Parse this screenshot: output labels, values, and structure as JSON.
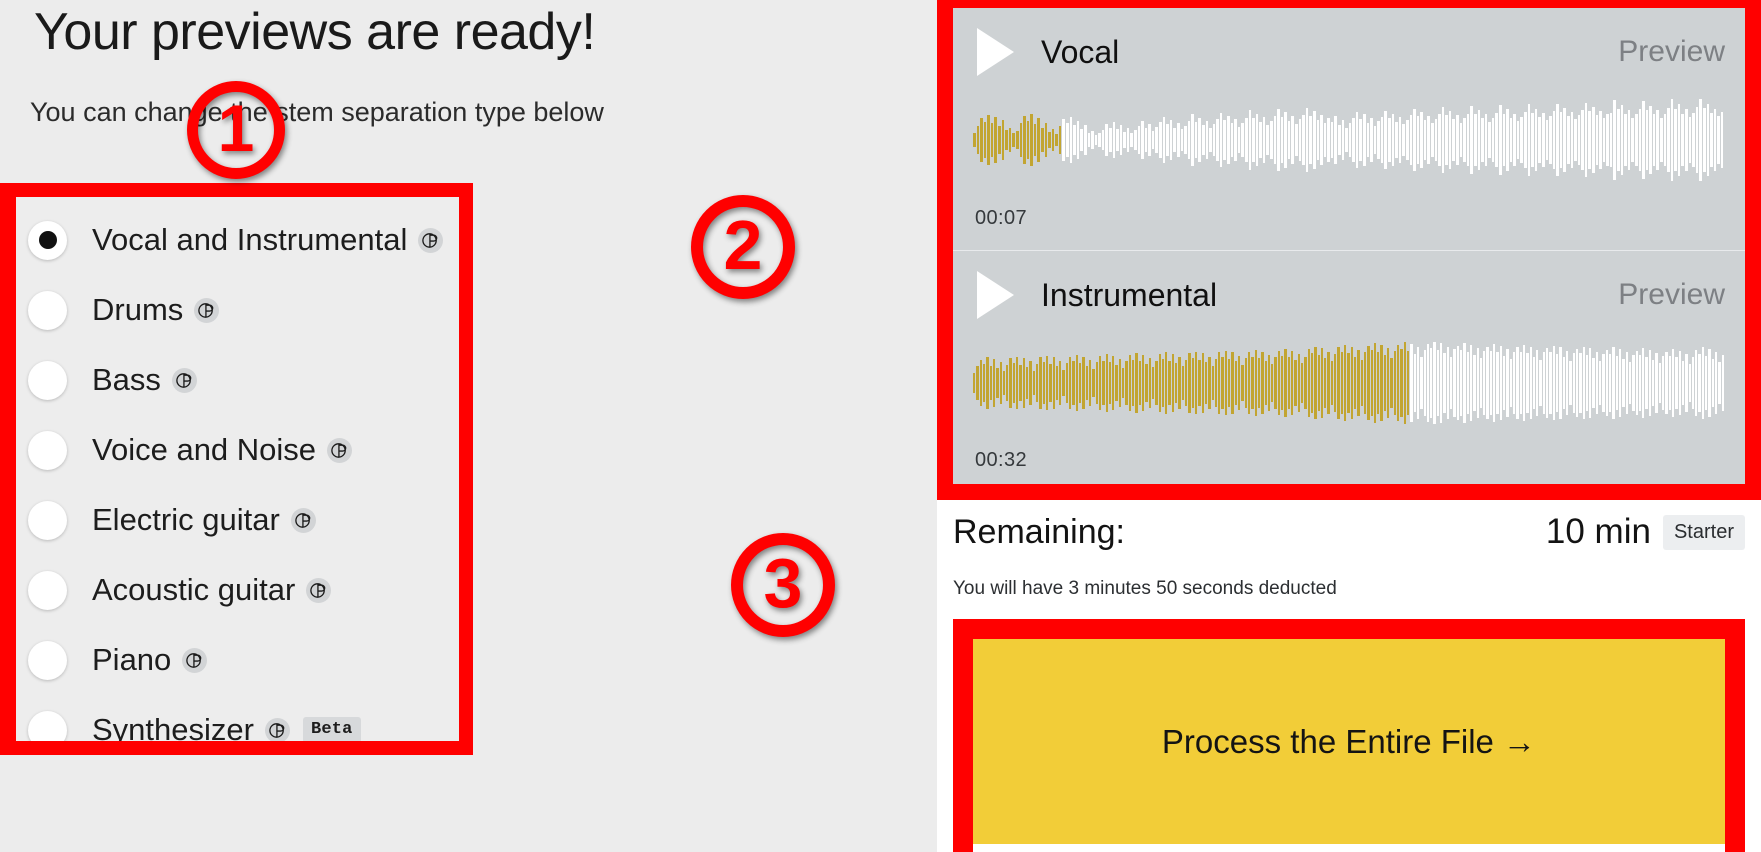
{
  "page": {
    "title": "Your previews are ready!",
    "subtitle": "You can change the stem separation type below",
    "background_color": "#ececec",
    "accent_color": "#f2cd38",
    "annotation_color": "#ff0000"
  },
  "stem_options": {
    "selected": "Vocal and Instrumental",
    "items": [
      {
        "label": "Vocal and Instrumental",
        "selected": true,
        "pro": true,
        "beta": null
      },
      {
        "label": "Drums",
        "selected": false,
        "pro": true,
        "beta": null
      },
      {
        "label": "Bass",
        "selected": false,
        "pro": true,
        "beta": null
      },
      {
        "label": "Voice and Noise",
        "selected": false,
        "pro": true,
        "beta": null
      },
      {
        "label": "Electric guitar",
        "selected": false,
        "pro": true,
        "beta": null
      },
      {
        "label": "Acoustic guitar",
        "selected": false,
        "pro": true,
        "beta": null
      },
      {
        "label": "Piano",
        "selected": false,
        "pro": true,
        "beta": null
      },
      {
        "label": "Synthesizer",
        "selected": false,
        "pro": true,
        "beta": "Beta"
      }
    ]
  },
  "previews": {
    "preview_label": "Preview",
    "waveform_played_color": "#c2a531",
    "waveform_unplayed_color": "#ffffff",
    "panel_color": "#ced2d4",
    "tracks": [
      {
        "name": "Vocal",
        "preview_label": "Preview",
        "timecode": "00:07",
        "progress_percent": 12,
        "waveform": [
          18,
          34,
          52,
          44,
          60,
          40,
          56,
          34,
          48,
          24,
          30,
          16,
          22,
          40,
          58,
          46,
          62,
          38,
          52,
          30,
          40,
          20,
          26,
          14,
          34,
          50,
          42,
          56,
          36,
          46,
          26,
          36,
          18,
          22,
          12,
          16,
          24,
          38,
          30,
          44,
          26,
          36,
          20,
          30,
          16,
          24,
          34,
          46,
          28,
          38,
          22,
          32,
          44,
          56,
          38,
          48,
          30,
          40,
          26,
          34,
          46,
          62,
          44,
          54,
          36,
          46,
          28,
          38,
          50,
          66,
          48,
          58,
          40,
          50,
          32,
          42,
          54,
          72,
          52,
          64,
          44,
          56,
          36,
          46,
          58,
          74,
          56,
          68,
          46,
          58,
          38,
          50,
          60,
          78,
          58,
          70,
          48,
          60,
          40,
          52,
          44,
          58,
          36,
          48,
          30,
          42,
          52,
          68,
          50,
          62,
          42,
          54,
          34,
          46,
          56,
          70,
          52,
          64,
          44,
          56,
          38,
          48,
          60,
          76,
          58,
          68,
          48,
          58,
          40,
          50,
          62,
          80,
          60,
          70,
          50,
          60,
          42,
          52,
          64,
          82,
          62,
          72,
          52,
          62,
          44,
          54,
          66,
          84,
          64,
          74,
          54,
          64,
          46,
          56,
          68,
          86,
          66,
          76,
          56,
          66,
          48,
          58,
          70,
          88,
          68,
          78,
          58,
          68,
          50,
          60,
          72,
          90,
          70,
          80,
          60,
          70,
          52,
          62,
          66,
          96,
          74,
          84,
          62,
          72,
          54,
          64,
          76,
          94,
          72,
          82,
          62,
          72,
          54,
          64,
          78,
          98,
          76,
          86,
          64,
          74,
          56,
          66,
          80,
          100,
          78,
          88,
          66,
          76,
          58,
          68
        ]
      },
      {
        "name": "Instrumental",
        "preview_label": "Preview",
        "timecode": "00:32",
        "progress_percent": 58,
        "waveform": [
          24,
          40,
          56,
          46,
          62,
          42,
          58,
          36,
          50,
          28,
          44,
          60,
          48,
          64,
          44,
          60,
          38,
          52,
          30,
          46,
          62,
          50,
          66,
          46,
          62,
          40,
          54,
          32,
          48,
          64,
          52,
          68,
          48,
          64,
          42,
          56,
          34,
          50,
          66,
          54,
          70,
          50,
          66,
          44,
          58,
          36,
          52,
          68,
          56,
          72,
          52,
          68,
          46,
          60,
          38,
          54,
          70,
          58,
          74,
          54,
          70,
          48,
          62,
          40,
          56,
          72,
          60,
          76,
          56,
          72,
          50,
          64,
          42,
          58,
          74,
          62,
          78,
          58,
          74,
          52,
          66,
          44,
          60,
          76,
          64,
          80,
          60,
          76,
          54,
          68,
          46,
          62,
          78,
          66,
          82,
          62,
          78,
          56,
          70,
          48,
          64,
          82,
          72,
          88,
          68,
          84,
          60,
          76,
          54,
          70,
          86,
          76,
          92,
          72,
          88,
          64,
          80,
          56,
          74,
          90,
          80,
          96,
          76,
          92,
          68,
          84,
          60,
          78,
          92,
          82,
          98,
          78,
          94,
          70,
          86,
          62,
          80,
          94,
          84,
          100,
          80,
          96,
          72,
          88,
          64,
          82,
          90,
          80,
          96,
          76,
          92,
          68,
          84,
          60,
          78,
          88,
          78,
          94,
          74,
          90,
          66,
          82,
          58,
          76,
          86,
          76,
          92,
          72,
          88,
          64,
          80,
          56,
          74,
          84,
          74,
          90,
          70,
          86,
          62,
          78,
          54,
          72,
          82,
          72,
          88,
          68,
          84,
          60,
          76,
          52,
          70,
          80,
          70,
          86,
          66,
          82,
          58,
          74,
          50,
          68,
          78,
          68,
          84,
          64,
          80,
          56,
          72,
          48,
          66,
          76,
          66,
          82,
          62,
          78,
          54,
          70,
          46,
          64,
          80,
          70,
          86,
          66,
          82,
          58,
          74,
          50,
          68
        ]
      }
    ]
  },
  "remaining": {
    "label": "Remaining:",
    "value": "10 min",
    "plan_badge": "Starter",
    "deduction_note": "You will have 3 minutes 50 seconds deducted"
  },
  "process_button": {
    "label": "Process the Entire File →"
  },
  "annotations": [
    {
      "id": "1",
      "label": "1"
    },
    {
      "id": "2",
      "label": "2"
    },
    {
      "id": "3",
      "label": "3"
    }
  ]
}
